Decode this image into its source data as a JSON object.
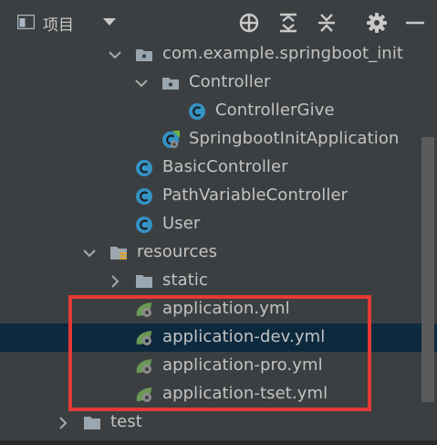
{
  "header": {
    "view_icon": "project-view-icon",
    "title": "项目",
    "dropdown_icon": "chevron-down-icon",
    "buttons": [
      {
        "name": "locate-file-button",
        "icon": "crosshair-icon"
      },
      {
        "name": "expand-all-button",
        "icon": "expand-all-icon"
      },
      {
        "name": "collapse-all-button",
        "icon": "collapse-all-icon"
      },
      {
        "name": "settings-button",
        "icon": "gear-icon"
      },
      {
        "name": "hide-panel-button",
        "icon": "minus-icon"
      }
    ]
  },
  "tree": {
    "items": [
      {
        "label": "com.example.springboot_init",
        "icon": "package-icon",
        "expanded": true
      },
      {
        "label": "Controller",
        "icon": "package-icon",
        "expanded": true
      },
      {
        "label": "ControllerGive",
        "icon": "class-icon"
      },
      {
        "label": "SpringbootInitApplication",
        "icon": "spring-boot-class-icon"
      },
      {
        "label": "BasicController",
        "icon": "class-icon"
      },
      {
        "label": "PathVariableController",
        "icon": "class-icon"
      },
      {
        "label": "User",
        "icon": "class-icon"
      },
      {
        "label": "resources",
        "icon": "resources-folder-icon",
        "expanded": true
      },
      {
        "label": "static",
        "icon": "folder-icon",
        "expanded": false
      },
      {
        "label": "application.yml",
        "icon": "spring-yml-icon"
      },
      {
        "label": "application-dev.yml",
        "icon": "spring-yml-icon",
        "selected": true
      },
      {
        "label": "application-pro.yml",
        "icon": "spring-yml-icon"
      },
      {
        "label": "application-tset.yml",
        "icon": "spring-yml-icon"
      },
      {
        "label": "test",
        "icon": "folder-icon",
        "expanded": false
      }
    ]
  },
  "colors": {
    "background": "#3c3f41",
    "selection": "#0d293e",
    "class_icon": "#3592c4",
    "spring_green": "#6a9955",
    "highlight_border": "#e53935"
  }
}
